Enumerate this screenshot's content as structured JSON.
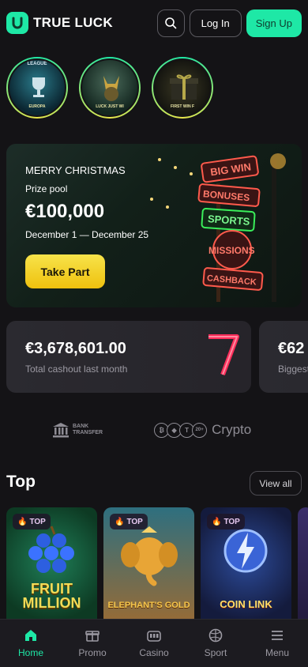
{
  "header": {
    "brand": "TRUE LUCK",
    "login_label": "Log In",
    "signup_label": "Sign Up"
  },
  "stories": [
    {
      "top": "LEAGUE",
      "caption": "EUROPA"
    },
    {
      "top": "",
      "caption": "LUCK JUST WI"
    },
    {
      "top": "",
      "caption": "FIRST WIN F"
    }
  ],
  "banner": {
    "kicker": "MERRY CHRISTMAS",
    "subtitle": "Prize pool",
    "amount": "€100,000",
    "dates": "December 1 — December 25",
    "cta": "Take Part",
    "signs": [
      "BIG WIN",
      "BONUSES",
      "SPORTS",
      "MISSIONS",
      "CASHBACK"
    ]
  },
  "stats": [
    {
      "amount": "€3,678,601.00",
      "label": "Total cashout last month"
    },
    {
      "amount": "€62",
      "label": "Biggest"
    }
  ],
  "payments": {
    "bank_line1": "BANK",
    "bank_line2": "TRANSFER",
    "crypto_label": "Crypto",
    "crypto_more": "20+"
  },
  "top_section": {
    "title": "Top",
    "view_all": "View all",
    "games": [
      {
        "tag": "TOP",
        "title": "FRUIT MILLION"
      },
      {
        "tag": "TOP",
        "title": "ELEPHANT'S GOLD"
      },
      {
        "tag": "TOP",
        "title": "COIN LINK"
      }
    ]
  },
  "nav": [
    {
      "label": "Home",
      "active": true
    },
    {
      "label": "Promo",
      "active": false
    },
    {
      "label": "Casino",
      "active": false
    },
    {
      "label": "Sport",
      "active": false
    },
    {
      "label": "Menu",
      "active": false
    }
  ],
  "colors": {
    "accent": "#1ee8a6",
    "cta_yellow": "#f7e34a",
    "background": "#141316"
  }
}
